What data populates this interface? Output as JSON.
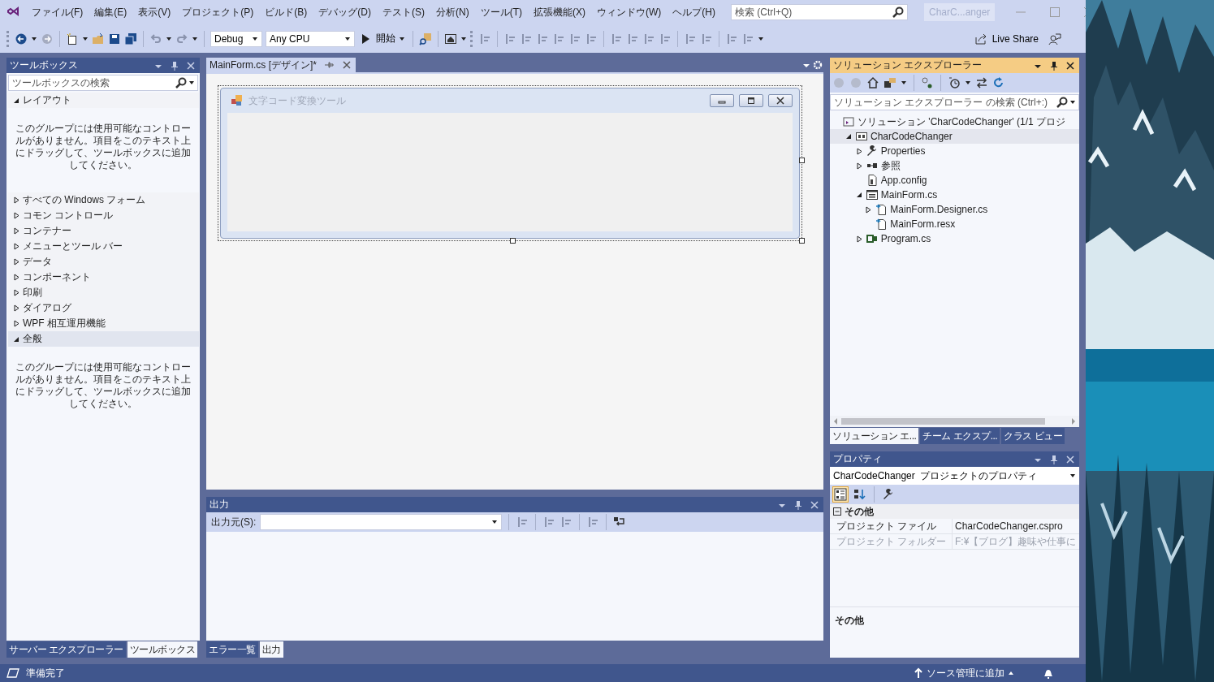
{
  "menu": [
    "ファイル(F)",
    "編集(E)",
    "表示(V)",
    "プロジェクト(P)",
    "ビルド(B)",
    "デバッグ(D)",
    "テスト(S)",
    "分析(N)",
    "ツール(T)",
    "拡張機能(X)",
    "ウィンドウ(W)",
    "ヘルプ(H)"
  ],
  "search": {
    "placeholder": "検索 (Ctrl+Q)"
  },
  "title_badge": "CharC...anger",
  "toolbar": {
    "configuration": "Debug",
    "platform": "Any CPU",
    "start": "開始",
    "live_share": "Live Share"
  },
  "toolbox": {
    "title": "ツールボックス",
    "search_placeholder": "ツールボックスの検索",
    "groups": [
      {
        "label": "レイアウト",
        "expanded": true,
        "selected": false,
        "empty_message": "このグループには使用可能なコントロールがありません。項目をこのテキスト上にドラッグして、ツールボックスに追加してください。"
      },
      {
        "label": "すべての Windows フォーム",
        "expanded": false,
        "selected": false
      },
      {
        "label": "コモン コントロール",
        "expanded": false,
        "selected": false
      },
      {
        "label": "コンテナー",
        "expanded": false,
        "selected": false
      },
      {
        "label": "メニューとツール バー",
        "expanded": false,
        "selected": false
      },
      {
        "label": "データ",
        "expanded": false,
        "selected": false
      },
      {
        "label": "コンポーネント",
        "expanded": false,
        "selected": false
      },
      {
        "label": "印刷",
        "expanded": false,
        "selected": false
      },
      {
        "label": "ダイアログ",
        "expanded": false,
        "selected": false
      },
      {
        "label": "WPF 相互運用機能",
        "expanded": false,
        "selected": false
      },
      {
        "label": "全般",
        "expanded": true,
        "selected": true,
        "empty_message": "このグループには使用可能なコントロールがありません。項目をこのテキスト上にドラッグして、ツールボックスに追加してください。"
      }
    ]
  },
  "left_tabs": [
    {
      "label": "サーバー エクスプローラー",
      "selected": false
    },
    {
      "label": "ツールボックス",
      "selected": true
    }
  ],
  "document_tabs": [
    {
      "label": "MainForm.cs [デザイン]*",
      "selected": true
    }
  ],
  "designer_form": {
    "title": "文字コード変換ツール"
  },
  "output": {
    "title": "出力",
    "source_label": "出力元(S):"
  },
  "bottom_tabs": [
    {
      "label": "エラー一覧",
      "selected": false
    },
    {
      "label": "出力",
      "selected": true
    }
  ],
  "solution_explorer": {
    "title": "ソリューション エクスプローラー",
    "search_placeholder": "ソリューション エクスプローラー の検索 (Ctrl+:)",
    "tree": [
      {
        "label": "ソリューション 'CharCodeChanger' (1/1 プロジ",
        "kind": "solution",
        "children": [
          {
            "label": "CharCodeChanger",
            "kind": "project",
            "expanded": true,
            "selected": true,
            "children": [
              {
                "label": "Properties",
                "kind": "properties",
                "expanded": false,
                "selected": false
              },
              {
                "label": "参照",
                "kind": "references",
                "expanded": false,
                "selected": false
              },
              {
                "label": "App.config",
                "kind": "config",
                "selected": false
              },
              {
                "label": "MainForm.cs",
                "kind": "form",
                "expanded": true,
                "selected": false,
                "children": [
                  {
                    "label": "MainForm.Designer.cs",
                    "kind": "code",
                    "expanded": false,
                    "selected": false
                  },
                  {
                    "label": "MainForm.resx",
                    "kind": "code",
                    "selected": false
                  }
                ]
              },
              {
                "label": "Program.cs",
                "kind": "csharp",
                "expanded": false,
                "selected": false
              }
            ]
          }
        ]
      }
    ]
  },
  "right_tabs": [
    {
      "label": "ソリューション エ...",
      "selected": true
    },
    {
      "label": "チーム エクスプ...",
      "selected": false
    },
    {
      "label": "クラス ビュー",
      "selected": false
    }
  ],
  "properties": {
    "title": "プロパティ",
    "object": "CharCodeChanger  プロジェクトのプロパティ",
    "category": "その他",
    "rows": [
      {
        "name": "プロジェクト ファイル",
        "value": "CharCodeChanger.cspro",
        "disabled": false
      },
      {
        "name": "プロジェクト フォルダー",
        "value": "F:¥【ブログ】趣味や仕事に",
        "disabled": true
      }
    ],
    "description_title": "その他"
  },
  "status": {
    "text": "準備完了",
    "source_control": "ソース管理に追加"
  }
}
